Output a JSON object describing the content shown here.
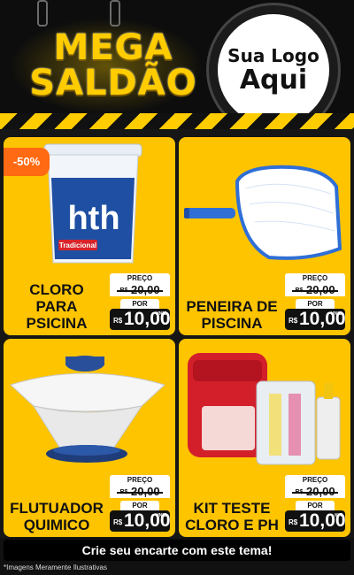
{
  "header": {
    "headline_line1": "MEGA",
    "headline_line2": "SALDÃO",
    "logo_line1": "Sua Logo",
    "logo_line2": "Aqui"
  },
  "products": [
    {
      "title": "CLORO PARA PSICINA",
      "discount_badge": "-50%",
      "image_icon": "chlorine-bucket-icon",
      "image_text": "hth",
      "image_subtext": "Tradicional",
      "price_label": "PREÇO",
      "old_currency": "R$",
      "old_price": "20,00",
      "por_label": "POR",
      "new_currency": "R$",
      "new_price": "10,00",
      "unit": "UNID"
    },
    {
      "title": "PENEIRA DE PISCINA",
      "image_icon": "pool-skimmer-net-icon",
      "price_label": "PREÇO",
      "old_currency": "R$",
      "old_price": "20,00",
      "por_label": "POR",
      "new_currency": "R$",
      "new_price": "10,00",
      "unit": "UNID"
    },
    {
      "title": "FLUTUADOR QUIMICO",
      "image_icon": "chemical-floater-icon",
      "price_label": "PREÇO",
      "old_currency": "R$",
      "old_price": "20,00",
      "por_label": "POR",
      "new_currency": "R$",
      "new_price": "10,00",
      "unit": "UNID"
    },
    {
      "title": "KIT TESTE CLORO E PH",
      "image_icon": "test-kit-icon",
      "price_label": "PREÇO",
      "old_currency": "R$",
      "old_price": "20,00",
      "por_label": "POR",
      "new_currency": "R$",
      "new_price": "10,00",
      "unit": "KIT"
    }
  ],
  "footer": {
    "cta": "Crie seu encarte com este tema!",
    "disclaimer": "*Imagens Meramente Ilustrativas"
  },
  "colors": {
    "accent_yellow": "#ffc400",
    "headline_yellow": "#ffcc00",
    "discount_orange": "#ff6a13",
    "background": "#111111"
  }
}
